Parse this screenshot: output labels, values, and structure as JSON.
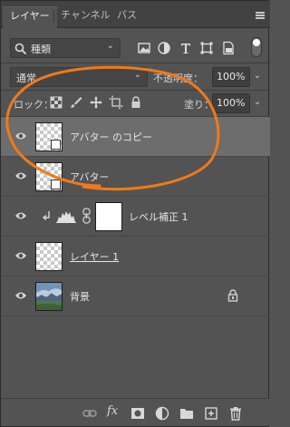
{
  "tabs": [
    {
      "label": "レイヤー",
      "active": true
    },
    {
      "label": "チャンネル",
      "active": false
    },
    {
      "label": "パス",
      "active": false
    }
  ],
  "filter": {
    "kind_label": "種類"
  },
  "blend": {
    "mode": "通常",
    "opacity_label": "不透明度：",
    "opacity_value": "100%"
  },
  "lock": {
    "label": "ロック：",
    "fill_label": "塗り：",
    "fill_value": "100%"
  },
  "layers": [
    {
      "name": "アバター のコピー",
      "selected": true,
      "type": "smart-object",
      "visible": true
    },
    {
      "name": "アバター",
      "selected": false,
      "type": "smart-object",
      "visible": true
    },
    {
      "name": "レベル補正 1",
      "selected": false,
      "type": "adjustment",
      "visible": true,
      "clipped": true
    },
    {
      "name": "レイヤー 1",
      "selected": false,
      "type": "pixel",
      "visible": true
    },
    {
      "name": "背景",
      "selected": false,
      "type": "background",
      "visible": true,
      "locked": true
    }
  ],
  "colors": {
    "panel_bg": "#535353",
    "selected_row": "#6d6d6d",
    "annotation_stroke": "#f07a1a"
  },
  "icons": {
    "link": "link-icon",
    "fx": "fx",
    "mask": "add-mask-icon",
    "adjustment": "adjustment-layer-icon",
    "group": "folder-icon",
    "new_layer": "new-layer-icon",
    "delete": "trash-icon"
  }
}
